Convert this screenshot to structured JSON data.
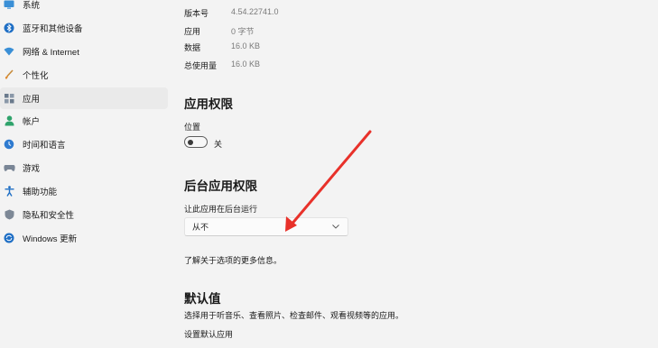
{
  "sidebar": {
    "items": [
      {
        "label": "系统",
        "icon": "system-icon"
      },
      {
        "label": "蓝牙和其他设备",
        "icon": "bluetooth-icon"
      },
      {
        "label": "网络 & Internet",
        "icon": "network-icon"
      },
      {
        "label": "个性化",
        "icon": "personalization-icon"
      },
      {
        "label": "应用",
        "icon": "apps-icon"
      },
      {
        "label": "帐户",
        "icon": "account-icon"
      },
      {
        "label": "时间和语言",
        "icon": "time-language-icon"
      },
      {
        "label": "游戏",
        "icon": "gaming-icon"
      },
      {
        "label": "辅助功能",
        "icon": "accessibility-icon"
      },
      {
        "label": "隐私和安全性",
        "icon": "privacy-shield-icon"
      },
      {
        "label": "Windows 更新",
        "icon": "windows-update-icon"
      }
    ],
    "active_index": 4
  },
  "app_info": {
    "version_label": "版本号",
    "version_value": "4.54.22741.0",
    "app_label": "应用",
    "app_value": "0 字节",
    "data_label": "数据",
    "data_value": "16.0 KB",
    "total_label": "总使用量",
    "total_value": "16.0 KB"
  },
  "permissions": {
    "title": "应用权限",
    "location_label": "位置",
    "location_state": "关",
    "location_on": false
  },
  "background": {
    "title": "后台应用权限",
    "run_label": "让此应用在后台运行",
    "selected": "从不",
    "learn_more": "了解关于选项的更多信息。"
  },
  "defaults": {
    "title": "默认值",
    "description": "选择用于听音乐、查看照片、检查邮件、观看视频等的应用。",
    "set_default_link": "设置默认应用"
  },
  "colors": {
    "background": "#f3f3f3",
    "active_item": "#eaeaea",
    "arrow": "#e8312a",
    "accent": "#0067c0"
  }
}
